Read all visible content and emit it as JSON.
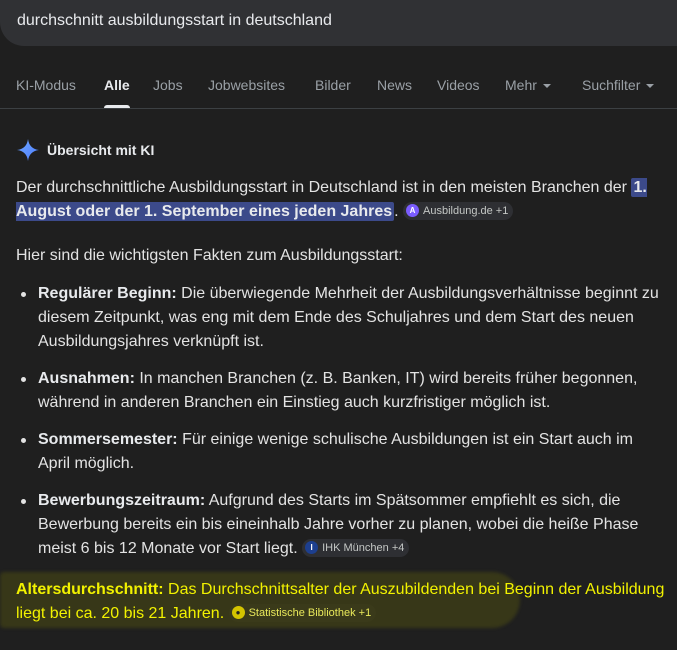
{
  "search": {
    "query": "durchschnitt ausbildungsstart in deutschland"
  },
  "tabs": [
    {
      "label": "KI-Modus"
    },
    {
      "label": "Alle"
    },
    {
      "label": "Jobs"
    },
    {
      "label": "Jobwebsites"
    },
    {
      "label": "Bilder"
    },
    {
      "label": "News"
    },
    {
      "label": "Videos"
    },
    {
      "label": "Mehr"
    },
    {
      "label": "Suchfilter"
    }
  ],
  "ai_overview": {
    "title": "Übersicht mit KI",
    "intro_text": "Der durchschnittliche Ausbildungsstart in Deutschland ist in den meisten Branchen der",
    "intro_highlight": "1. August oder der 1. September eines jeden Jahres",
    "intro_end": ".",
    "intro_source": "Ausbildung.de +1",
    "facts_heading": "Hier sind die wichtigsten Fakten zum Ausbildungsstart:",
    "facts": [
      {
        "term": "Regulärer Beginn:",
        "text": "Die überwiegende Mehrheit der Ausbildungsverhältnisse beginnt zu diesem Zeitpunkt, was eng mit dem Ende des Schuljahres und dem Start des neuen Ausbildungsjahres verknüpft ist."
      },
      {
        "term": "Ausnahmen:",
        "text": "In manchen Branchen (z. B. Banken, IT) wird bereits früher begonnen, während in anderen Branchen ein Einstieg auch kurzfristiger möglich ist."
      },
      {
        "term": "Sommersemester:",
        "text": "Für einige wenige schulische Ausbildungen ist ein Start auch im April möglich."
      },
      {
        "term": "Bewerbungszeitraum:",
        "text": "Aufgrund des Starts im Spätsommer empfiehlt es sich, die Bewerbung bereits ein bis eineinhalb Jahre vorher zu planen, wobei die heiße Phase meist 6 bis 12 Monate vor Start liegt.",
        "source": "IHK München +4"
      }
    ],
    "age": {
      "term": "Altersdurchschnitt:",
      "text": "Das Durchschnittsalter der Auszubildenden bei Beginn der Ausbildung liegt bei ca. 20 bis 21 Jahren.",
      "source": "Statistische Bibliothek +1"
    }
  },
  "colors": {
    "background": "#1f1f1f",
    "highlight_blue": "#3c4a8a",
    "highlight_yellow": "#f2f200"
  }
}
